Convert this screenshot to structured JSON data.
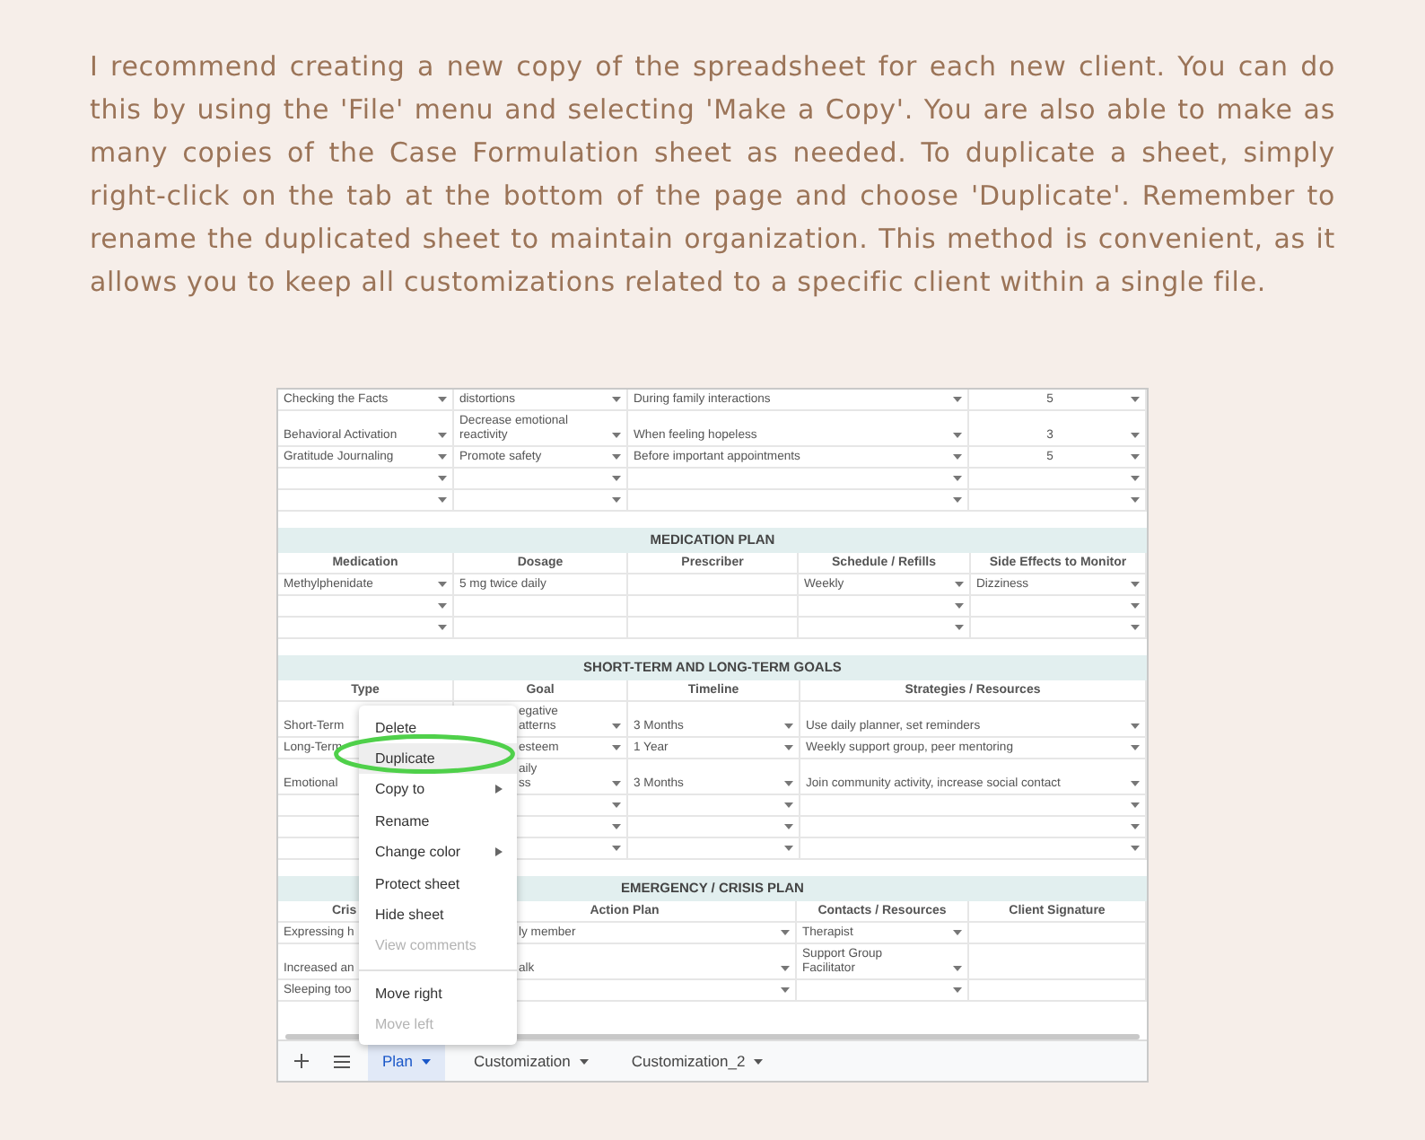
{
  "paragraph": "I recommend creating a new copy of the spreadsheet for each new client. You can do this by using the 'File' menu and selecting 'Make a Copy'. You are also able to make as many copies of the Case Formulation sheet as needed. To duplicate a sheet, simply right-click on the tab at the bottom of the page and choose 'Duplicate'. Remember to rename the duplicated sheet to maintain organization. This method is convenient, as it allows you to keep all customizations related to a specific client within a single file.",
  "sheet": {
    "sections": [
      {
        "dropdown": [
          true,
          true,
          true,
          true
        ],
        "rows": [
          [
            "Checking the Facts",
            "distortions",
            "During family interactions",
            "5"
          ],
          [
            "Behavioral Activation",
            "Decrease emotional reactivity",
            "When feeling hopeless",
            "3"
          ],
          [
            "Gratitude Journaling",
            "Promote safety",
            "Before important appointments",
            "5"
          ],
          [
            "",
            "",
            "",
            ""
          ],
          [
            "",
            "",
            "",
            ""
          ]
        ]
      },
      {
        "title": "MEDICATION PLAN",
        "headers": [
          "Medication",
          "Dosage",
          "Prescriber",
          "Schedule / Refills",
          "Side Effects to Monitor"
        ],
        "dropdown": [
          true,
          false,
          false,
          true,
          true
        ],
        "rows": [
          [
            "Methylphenidate",
            "5 mg twice daily",
            "",
            "Weekly",
            "Dizziness"
          ],
          [
            "",
            "",
            "",
            "",
            ""
          ],
          [
            "",
            "",
            "",
            "",
            ""
          ]
        ]
      },
      {
        "title": "SHORT-TERM AND LONG-TERM GOALS",
        "headers": [
          "Type",
          "Goal",
          "Timeline",
          "Strategies / Resources"
        ],
        "dropdown": [
          false,
          true,
          true,
          true
        ],
        "rows": [
          [
            "Short-Term",
            "egative\natterns",
            "3 Months",
            "Use daily planner, set reminders"
          ],
          [
            "Long-Term",
            "esteem",
            "1 Year",
            "Weekly support group, peer mentoring"
          ],
          [
            "Emotional",
            "aily\nss",
            "3 Months",
            "Join community activity, increase social contact"
          ],
          [
            "",
            "",
            "",
            ""
          ],
          [
            "",
            "",
            "",
            ""
          ],
          [
            "",
            "",
            "",
            ""
          ]
        ]
      },
      {
        "title": "EMERGENCY / CRISIS PLAN",
        "headers": [
          "Cris",
          "Action Plan",
          "Contacts / Resources",
          "Client Signature"
        ],
        "dropdown": [
          false,
          true,
          true,
          false
        ],
        "rows": [
          [
            "Expressing h",
            "ly member",
            "Therapist",
            ""
          ],
          [
            "Increased an",
            "alk",
            "Support Group\nFacilitator",
            ""
          ],
          [
            "Sleeping too",
            "",
            "",
            ""
          ]
        ]
      }
    ],
    "context_menu": [
      {
        "kind": "item",
        "label": "Delete",
        "selected": false,
        "disabled": false,
        "submenu": false
      },
      {
        "kind": "item",
        "label": "Duplicate",
        "selected": true,
        "disabled": false,
        "submenu": false
      },
      {
        "kind": "item",
        "label": "Copy to",
        "selected": false,
        "disabled": false,
        "submenu": true
      },
      {
        "kind": "item",
        "label": "Rename",
        "selected": false,
        "disabled": false,
        "submenu": false
      },
      {
        "kind": "item",
        "label": "Change color",
        "selected": false,
        "disabled": false,
        "submenu": true
      },
      {
        "kind": "item",
        "label": "Protect sheet",
        "selected": false,
        "disabled": false,
        "submenu": false
      },
      {
        "kind": "item",
        "label": "Hide sheet",
        "selected": false,
        "disabled": false,
        "submenu": false
      },
      {
        "kind": "item",
        "label": "View comments",
        "selected": false,
        "disabled": true,
        "submenu": false
      },
      {
        "kind": "divider"
      },
      {
        "kind": "item",
        "label": "Move right",
        "selected": false,
        "disabled": false,
        "submenu": false
      },
      {
        "kind": "item",
        "label": "Move left",
        "selected": false,
        "disabled": true,
        "submenu": false
      }
    ],
    "tabs": [
      {
        "label": "Plan",
        "selected": true
      },
      {
        "label": "Customization",
        "selected": false
      },
      {
        "label": "Customization_2",
        "selected": false
      }
    ]
  }
}
